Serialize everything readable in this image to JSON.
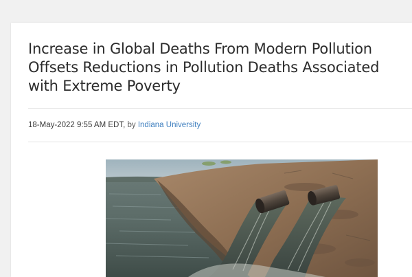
{
  "article": {
    "title": "Increase in Global Deaths From Modern Pollution Offsets Reductions in Pollution Deaths Associated with Extreme Poverty",
    "date": "18-May-2022 9:55 AM EDT",
    "date_suffix": ",",
    "by_label": "by",
    "source": "Indiana University"
  },
  "colors": {
    "link": "#3f7fbf",
    "title": "#2b2b2b"
  }
}
